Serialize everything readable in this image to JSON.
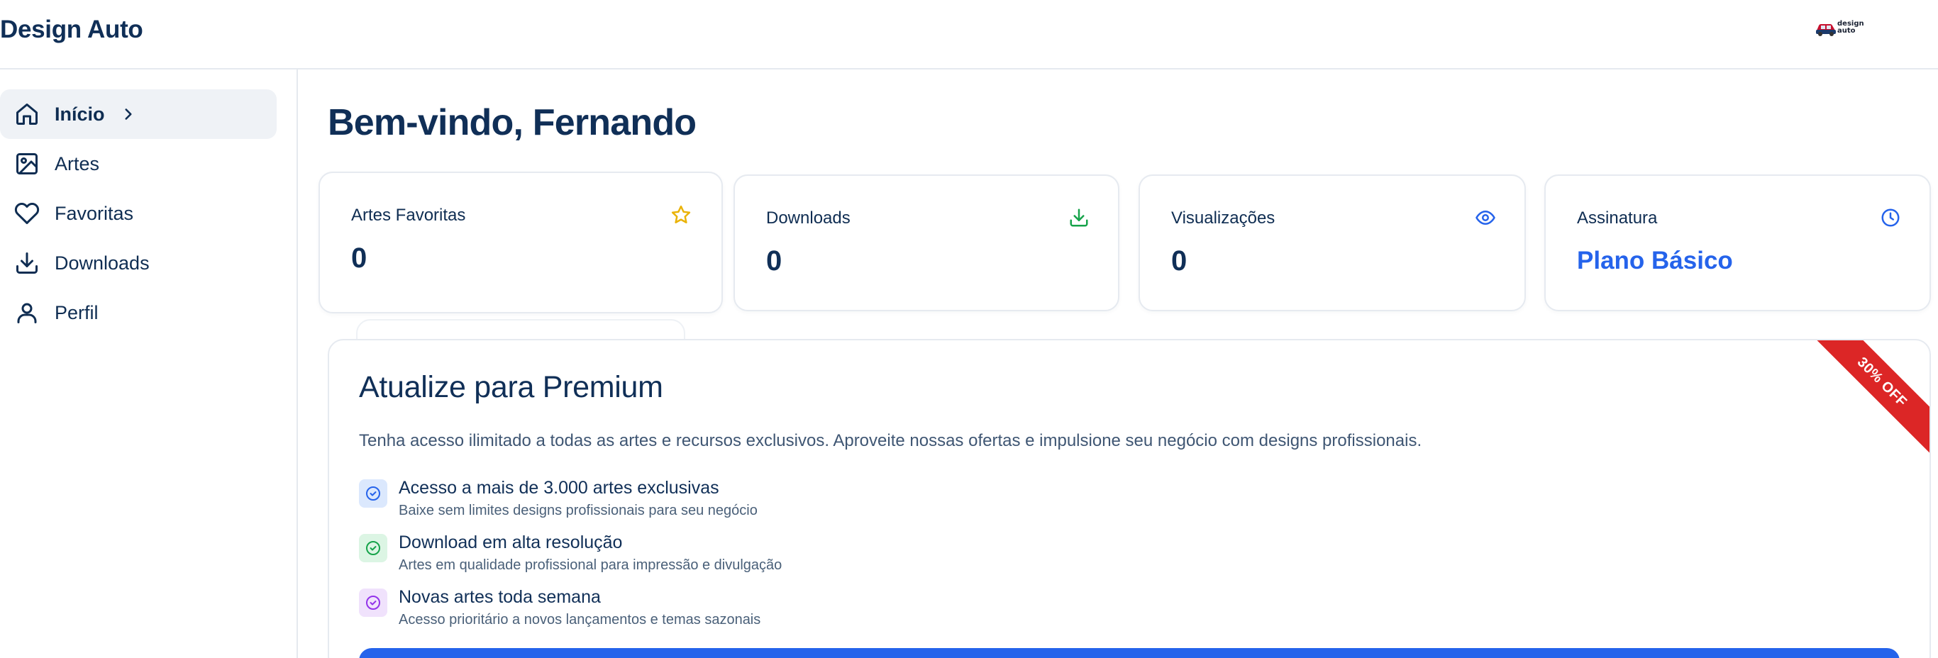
{
  "header": {
    "brand": "Design Auto",
    "logo_line1": "design",
    "logo_line2": "auto"
  },
  "sidebar": {
    "items": [
      {
        "label": "Início",
        "icon": "home-icon",
        "active": true
      },
      {
        "label": "Artes",
        "icon": "image-icon",
        "active": false
      },
      {
        "label": "Favoritas",
        "icon": "heart-icon",
        "active": false
      },
      {
        "label": "Downloads",
        "icon": "download-icon",
        "active": false
      },
      {
        "label": "Perfil",
        "icon": "user-icon",
        "active": false
      }
    ]
  },
  "main": {
    "title": "Bem-vindo, Fernando",
    "stats": [
      {
        "label": "Artes Favoritas",
        "value": "0",
        "icon": "star-icon",
        "color": "#eab308"
      },
      {
        "label": "Downloads",
        "value": "0",
        "icon": "download-icon",
        "color": "#16a34a"
      },
      {
        "label": "Visualizações",
        "value": "0",
        "icon": "eye-icon",
        "color": "#2563eb"
      },
      {
        "label": "Assinatura",
        "value": "Plano Básico",
        "icon": "clock-icon",
        "color": "#2563eb"
      }
    ],
    "premium": {
      "title": "Atualize para Premium",
      "ribbon": "30% OFF",
      "description": "Tenha acesso ilimitado a todas as artes e recursos exclusivos. Aproveite nossas ofertas e impulsione seu negócio com designs profissionais.",
      "features": [
        {
          "title": "Acesso a mais de 3.000 artes exclusivas",
          "subtitle": "Baixe sem limites designs profissionais para seu negócio",
          "color": "#2563eb",
          "bg": "#dbe8fd"
        },
        {
          "title": "Download em alta resolução",
          "subtitle": "Artes em qualidade profissional para impressão e divulgação",
          "color": "#16a34a",
          "bg": "#dcf5e4"
        },
        {
          "title": "Novas artes toda semana",
          "subtitle": "Acesso prioritário a novos lançamentos e temas sazonais",
          "color": "#9333ea",
          "bg": "#f0e2fc"
        }
      ]
    }
  },
  "colors": {
    "primary": "#2563eb",
    "text": "#102f57",
    "ribbon": "#dc2626"
  }
}
